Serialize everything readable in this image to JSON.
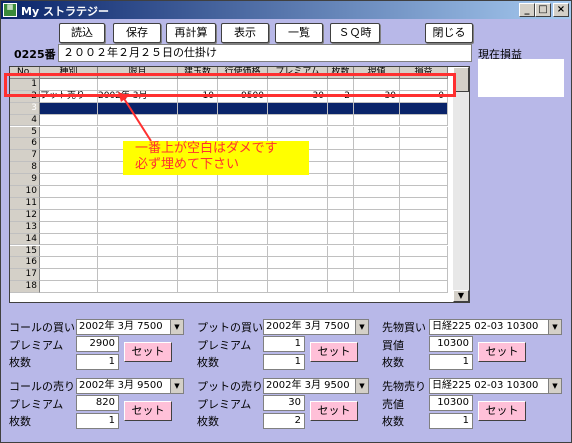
{
  "window": {
    "title": "My ストラテジー",
    "controls": {
      "min": "_",
      "max": "□",
      "close": "×"
    }
  },
  "toolbar": {
    "load": "読込",
    "save": "保存",
    "recalc": "再計算",
    "show": "表示",
    "list": "一覧",
    "sq": "ＳＱ時",
    "close": "閉じる"
  },
  "header": {
    "code": "0225番",
    "date": "２００２年２月２５日の仕掛け",
    "pnl_label": "現在損益"
  },
  "grid": {
    "columns": [
      "No.",
      "種別",
      "限月",
      "建玉数",
      "行使価格",
      "プレミアム",
      "枚数",
      "現値",
      "損益"
    ],
    "rows": [
      {
        "no": "1",
        "type": "",
        "month": "",
        "pos": "",
        "strike": "",
        "prem": "",
        "qty": "",
        "now": "",
        "pl": ""
      },
      {
        "no": "2",
        "type": "プット売り",
        "month": "2002年 3月",
        "pos": "10",
        "strike": "9500",
        "prem": "30",
        "qty": "2",
        "now": "30",
        "pl": "0"
      },
      {
        "no": "3",
        "type": "",
        "month": "",
        "pos": "",
        "strike": "",
        "prem": "",
        "qty": "",
        "now": "",
        "pl": ""
      },
      {
        "no": "4"
      },
      {
        "no": "5"
      },
      {
        "no": "6"
      },
      {
        "no": "7"
      },
      {
        "no": "8"
      },
      {
        "no": "9"
      },
      {
        "no": "10"
      },
      {
        "no": "11"
      },
      {
        "no": "12"
      },
      {
        "no": "13"
      },
      {
        "no": "14"
      },
      {
        "no": "15"
      },
      {
        "no": "16"
      },
      {
        "no": "17"
      },
      {
        "no": "18"
      }
    ]
  },
  "annotation": {
    "line1": "一番上が空白はダメです",
    "line2": "必ず埋めて下さい"
  },
  "forms": {
    "call_buy": {
      "label": "コールの買い",
      "select": "2002年 3月 7500",
      "prem_label": "プレミアム",
      "prem": "2900",
      "qty_label": "枚数",
      "qty": "1",
      "set": "セット"
    },
    "put_buy": {
      "label": "プットの買い",
      "select": "2002年 3月 7500",
      "prem_label": "プレミアム",
      "prem": "1",
      "qty_label": "枚数",
      "qty": "1",
      "set": "セット"
    },
    "fut_buy": {
      "label": "先物買い",
      "select": "日経225  02-03 10300",
      "price_label": "買値",
      "price": "10300",
      "qty_label": "枚数",
      "qty": "1",
      "set": "セット"
    },
    "call_sell": {
      "label": "コールの売り",
      "select": "2002年 3月 9500",
      "prem_label": "プレミアム",
      "prem": "820",
      "qty_label": "枚数",
      "qty": "1",
      "set": "セット"
    },
    "put_sell": {
      "label": "プットの売り",
      "select": "2002年 3月 9500",
      "prem_label": "プレミアム",
      "prem": "30",
      "qty_label": "枚数",
      "qty": "2",
      "set": "セット"
    },
    "fut_sell": {
      "label": "先物売り",
      "select": "日経225  02-03 10300",
      "price_label": "売値",
      "price": "10300",
      "qty_label": "枚数",
      "qty": "1",
      "set": "セット"
    }
  }
}
